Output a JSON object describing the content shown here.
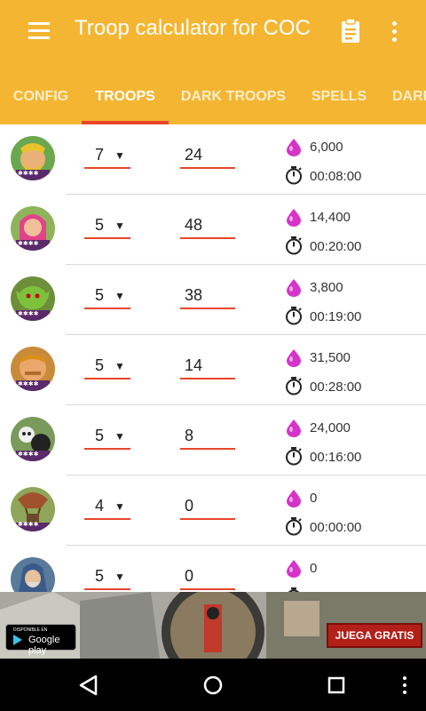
{
  "app": {
    "title": "Troop calculator for COC"
  },
  "tabs": [
    {
      "label": "CONFIG"
    },
    {
      "label": "TROOPS"
    },
    {
      "label": "DARK TROOPS"
    },
    {
      "label": "SPELLS"
    },
    {
      "label": "DARK"
    }
  ],
  "active_tab": "TROOPS",
  "troops": [
    {
      "icon": "barbarian-icon",
      "level": "7",
      "quantity": "24",
      "cost": "6,000",
      "time": "00:08:00"
    },
    {
      "icon": "archer-icon",
      "level": "5",
      "quantity": "48",
      "cost": "14,400",
      "time": "00:20:00"
    },
    {
      "icon": "goblin-icon",
      "level": "5",
      "quantity": "38",
      "cost": "3,800",
      "time": "00:19:00"
    },
    {
      "icon": "giant-icon",
      "level": "5",
      "quantity": "14",
      "cost": "31,500",
      "time": "00:28:00"
    },
    {
      "icon": "wall-breaker-icon",
      "level": "5",
      "quantity": "8",
      "cost": "24,000",
      "time": "00:16:00"
    },
    {
      "icon": "balloon-icon",
      "level": "4",
      "quantity": "0",
      "cost": "0",
      "time": "00:00:00"
    },
    {
      "icon": "wizard-icon",
      "level": "5",
      "quantity": "0",
      "cost": "0",
      "time": ""
    }
  ],
  "ad": {
    "store_small": "DISPONIBLE EN",
    "store_big": "Google play",
    "cta": "JUEGA GRATIS"
  },
  "colors": {
    "accent": "#f4b632",
    "indicator": "#e8462a",
    "elixir": "#d633c8"
  }
}
